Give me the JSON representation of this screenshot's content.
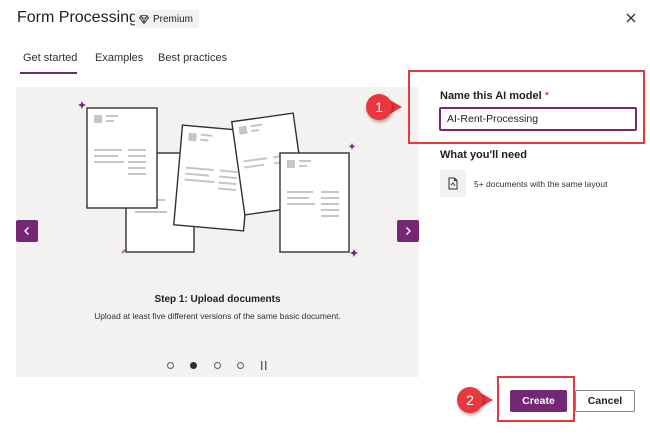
{
  "header": {
    "title": "Form Processing",
    "premium_badge": "Premium",
    "premium_icon": "diamond-icon",
    "close_icon": "close-icon"
  },
  "tabs": [
    {
      "label": "Get started",
      "active": true
    },
    {
      "label": "Examples",
      "active": false
    },
    {
      "label": "Best practices",
      "active": false
    }
  ],
  "carousel": {
    "step_title": "Step 1: Upload documents",
    "step_description": "Upload at least five different versions of the same basic document.",
    "total_steps": 4,
    "active_step": 2,
    "prev_icon": "chevron-left-icon",
    "next_icon": "chevron-right-icon",
    "pause_icon": "pause-icon"
  },
  "form": {
    "name_label": "Name this AI model",
    "required_marker": "*",
    "name_value": "AI-Rent-Processing",
    "need_label": "What you'll need",
    "need_item": "5+ documents with the same layout",
    "need_icon": "document-icon"
  },
  "footer": {
    "create_label": "Create",
    "cancel_label": "Cancel"
  },
  "annotations": {
    "badge1": "1",
    "badge2": "2"
  },
  "colors": {
    "accent": "#742774",
    "annotation": "#e8373d",
    "panel_bg": "#f3f2f1"
  }
}
